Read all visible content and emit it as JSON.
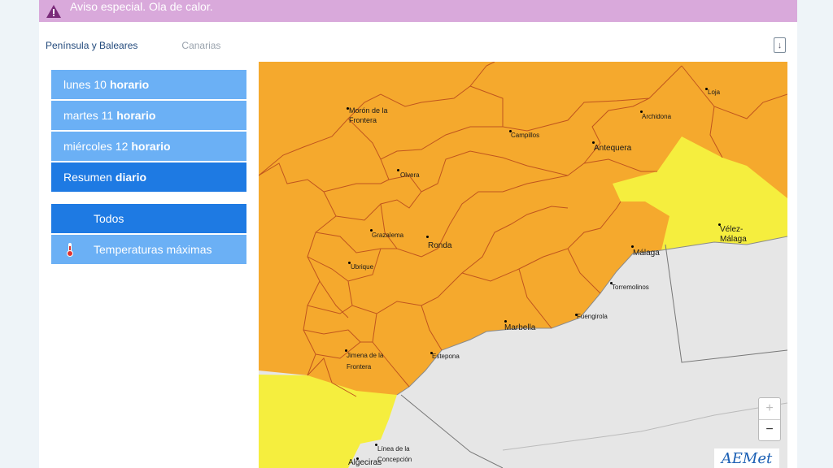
{
  "alert": {
    "text": "Aviso especial. Ola de calor."
  },
  "region_tabs": [
    {
      "label": "Península y Baleares",
      "active": true
    },
    {
      "label": "Canarias",
      "active": false
    }
  ],
  "day_menu": [
    {
      "prefix": "lunes 10",
      "suffix": "horario",
      "selected": false
    },
    {
      "prefix": "martes 11",
      "suffix": "horario",
      "selected": false
    },
    {
      "prefix": "miércoles 12",
      "suffix": "horario",
      "selected": false
    },
    {
      "prefix": "Resumen",
      "suffix": "diario",
      "selected": true
    }
  ],
  "filter_menu": [
    {
      "label": "Todos",
      "icon": null
    },
    {
      "label": "Temperaturas máximas",
      "icon": "thermometer-icon"
    }
  ],
  "map": {
    "towns": [
      {
        "name": "Morón de la Frontera"
      },
      {
        "name": "Olvera"
      },
      {
        "name": "Campillos"
      },
      {
        "name": "Antequera"
      },
      {
        "name": "Archidona"
      },
      {
        "name": "Loja"
      },
      {
        "name": "Grazalema"
      },
      {
        "name": "Ronda"
      },
      {
        "name": "Ubrique"
      },
      {
        "name": "Vélez-Málaga"
      },
      {
        "name": "Málaga"
      },
      {
        "name": "Torremolinos"
      },
      {
        "name": "Fuengirola"
      },
      {
        "name": "Marbella"
      },
      {
        "name": "Estepona"
      },
      {
        "name": "Jimena de la Frontera"
      },
      {
        "name": "Línea de la Concepción"
      },
      {
        "name": "Algeciras"
      }
    ],
    "zoom_in": "+",
    "zoom_out": "−",
    "logo": "AEMet",
    "colors": {
      "orange": "#f5a92d",
      "yellow": "#f5ee3e",
      "sea": "#e6e6e6",
      "accent": "#1e7ae3"
    }
  },
  "download_icon": "↓"
}
